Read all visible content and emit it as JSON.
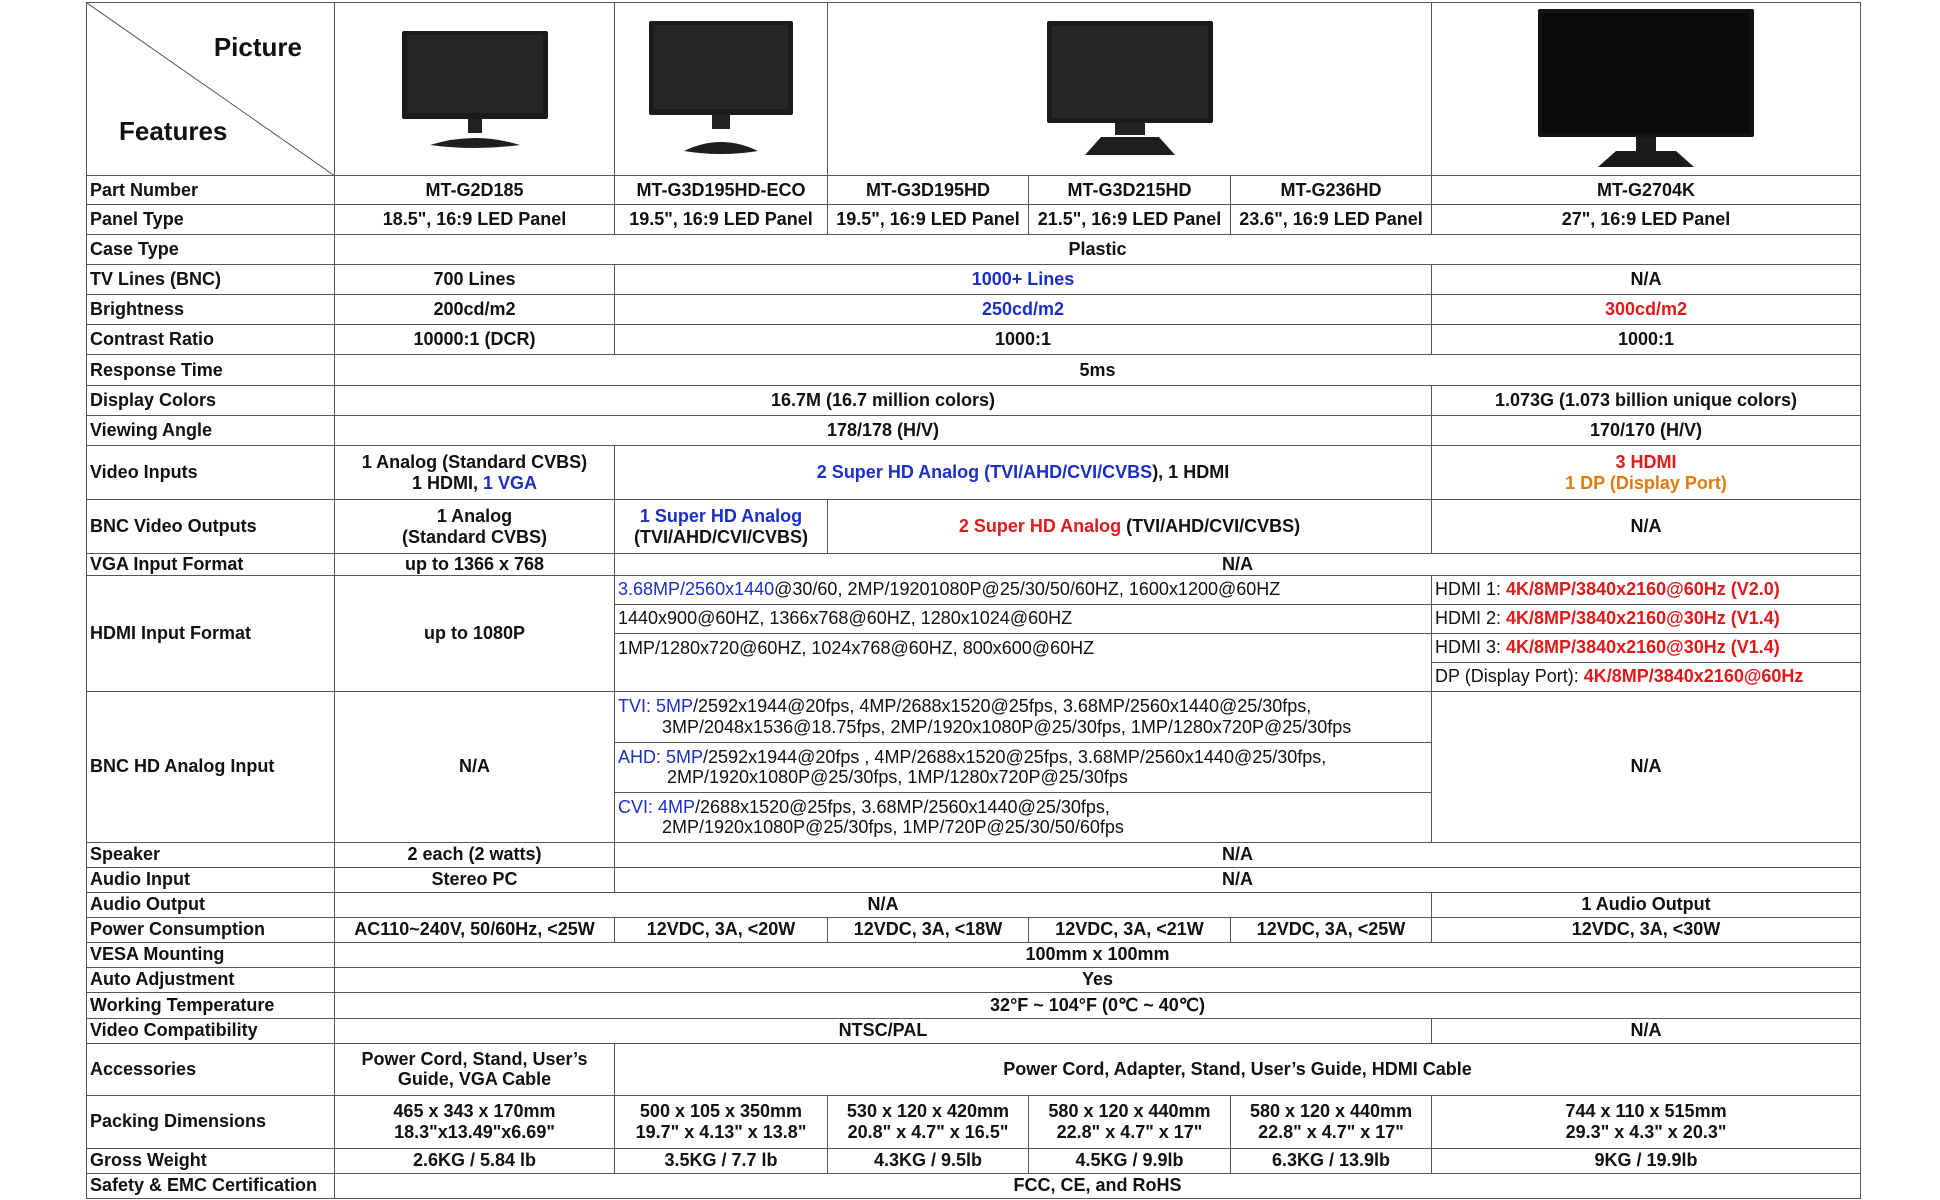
{
  "header": {
    "picture": "Picture",
    "features": "Features"
  },
  "rows": {
    "part_number": {
      "label": "Part Number",
      "v": [
        "MT-G2D185",
        "MT-G3D195HD-ECO",
        "MT-G3D195HD",
        "MT-G3D215HD",
        "MT-G236HD",
        "MT-G2704K"
      ]
    },
    "panel_type": {
      "label": "Panel Type",
      "v": [
        "18.5\", 16:9 LED Panel",
        "19.5\", 16:9 LED Panel",
        "19.5\", 16:9 LED Panel",
        "21.5\", 16:9 LED Panel",
        "23.6\", 16:9 LED Panel",
        "27\", 16:9 LED Panel"
      ]
    },
    "case_type": {
      "label": "Case Type",
      "v": "Plastic"
    },
    "tv_lines": {
      "label": "TV Lines (BNC)",
      "v": [
        "700 Lines",
        "1000+ Lines",
        "N/A"
      ]
    },
    "brightness": {
      "label": "Brightness",
      "v": [
        "200cd/m2",
        "250cd/m2",
        "300cd/m2"
      ]
    },
    "contrast": {
      "label": "Contrast Ratio",
      "v": [
        "10000:1 (DCR)",
        "1000:1",
        "1000:1"
      ]
    },
    "response": {
      "label": "Response Time",
      "v": "5ms"
    },
    "colors": {
      "label": "Display Colors",
      "v": [
        "16.7M (16.7 million colors)",
        "1.073G (1.073 billion unique colors)"
      ]
    },
    "viewing": {
      "label": "Viewing Angle",
      "v": [
        "178/178 (H/V)",
        "170/170 (H/V)"
      ]
    },
    "video_inputs": {
      "label": "Video Inputs",
      "c1a": "1 Analog (Standard CVBS)",
      "c1b": "1 HDMI, ",
      "c1c": "1 VGA",
      "c2a": "2 Super HD Analog (",
      "c2b": "TVI/AHD/CVI/CVBS",
      "c2c": "), 1 HDMI",
      "c3a": "3 HDMI",
      "c3b": "1 DP (Display Port)"
    },
    "bnc_out": {
      "label": "BNC Video Outputs",
      "c1a": "1 Analog",
      "c1b": "(Standard CVBS)",
      "c2a": "1 Super HD Analog",
      "c2b": "(TVI/AHD/CVI/CVBS)",
      "c3a": "2 Super HD Analog",
      "c3b": " (TVI/AHD/CVI/CVBS)",
      "c4": "N/A"
    },
    "vga": {
      "label": "VGA Input Format",
      "v": [
        "up to 1366 x 768",
        "N/A"
      ]
    },
    "hdmi_in": {
      "label": "HDMI Input Format",
      "c1": "up to 1080P",
      "mid1a": "3.68MP/2560x1440",
      "mid1b": "@30/60, 2MP/19201080P@25/30/50/60HZ, 1600x1200@60HZ",
      "mid2": "1440x900@60HZ, 1366x768@60HZ, 1280x1024@60HZ",
      "mid3": "1MP/1280x720@60HZ, 1024x768@60HZ, 800x600@60HZ",
      "r1a": "HDMI 1: ",
      "r1b": "4K/8MP/3840x2160@60Hz (V2.0)",
      "r2a": "HDMI 2: ",
      "r2b": "4K/8MP/3840x2160@30Hz (V1.4)",
      "r3a": "HDMI 3: ",
      "r3b": "4K/8MP/3840x2160@30Hz (V1.4)",
      "r4a": "DP (Display Port): ",
      "r4b": "4K/8MP/3840x2160@60Hz"
    },
    "bnc_hd": {
      "label": "BNC HD Analog Input",
      "c1": "N/A",
      "c3": "N/A",
      "tvi_a": "TVI: ",
      "tvi_b": "5MP",
      "tvi_c": "/2592x1944@20fps, 4MP/2688x1520@25fps, 3.68MP/2560x1440@25/30fps,",
      "tvi_d": "3MP/2048x1536@18.75fps, 2MP/1920x1080P@25/30fps, 1MP/1280x720P@25/30fps",
      "ahd_a": "AHD: ",
      "ahd_b": "5MP",
      "ahd_c": "/2592x1944@20fps , 4MP/2688x1520@25fps, 3.68MP/2560x1440@25/30fps,",
      "ahd_d": "2MP/1920x1080P@25/30fps, 1MP/1280x720P@25/30fps",
      "cvi_a": "CVI: ",
      "cvi_b": "4MP",
      "cvi_c": "/2688x1520@25fps, 3.68MP/2560x1440@25/30fps,",
      "cvi_d": "2MP/1920x1080P@25/30fps, 1MP/720P@25/30/50/60fps"
    },
    "speaker": {
      "label": "Speaker",
      "v": [
        "2 each (2 watts)",
        "N/A"
      ]
    },
    "audio_in": {
      "label": "Audio Input",
      "v": [
        "Stereo PC",
        "N/A"
      ]
    },
    "audio_out": {
      "label": "Audio Output",
      "v": [
        "N/A",
        "1 Audio Output"
      ]
    },
    "power": {
      "label": "Power Consumption",
      "v": [
        "AC110~240V, 50/60Hz, <25W",
        "12VDC, 3A, <20W",
        "12VDC, 3A, <18W",
        "12VDC, 3A, <21W",
        "12VDC, 3A, <25W",
        "12VDC, 3A, <30W"
      ]
    },
    "vesa": {
      "label": "VESA Mounting",
      "v": "100mm x 100mm"
    },
    "auto_adj": {
      "label": "Auto Adjustment",
      "v": "Yes"
    },
    "temp": {
      "label": "Working Temperature",
      "v": "32°F ~ 104°F (0℃ ~ 40℃)"
    },
    "compat": {
      "label": "Video Compatibility",
      "v": [
        "NTSC/PAL",
        "N/A"
      ]
    },
    "accessories": {
      "label": "Accessories",
      "c1a": "Power Cord, Stand, User’s",
      "c1b": "Guide, VGA Cable",
      "c2": "Power Cord, Adapter, Stand, User’s Guide, HDMI Cable"
    },
    "packing": {
      "label": "Packing Dimensions",
      "a": [
        "465 x 343 x 170mm",
        "500 x 105 x 350mm",
        "530 x 120 x 420mm",
        "580 x 120 x 440mm",
        "580 x 120 x 440mm",
        "744 x 110 x 515mm"
      ],
      "b": [
        "18.3\"x13.49\"x6.69\"",
        "19.7\" x 4.13\" x 13.8\"",
        "20.8\" x 4.7\" x 16.5\"",
        "22.8\" x 4.7\" x 17\"",
        "22.8\" x 4.7\" x 17\"",
        "29.3\" x 4.3\" x 20.3\""
      ]
    },
    "weight": {
      "label": "Gross Weight",
      "v": [
        "2.6KG / 5.84 lb",
        "3.5KG / 7.7 lb",
        "4.3KG / 9.5lb",
        "4.5KG / 9.9lb",
        "6.3KG / 13.9lb",
        "9KG / 19.9lb"
      ]
    },
    "cert": {
      "label": "Safety & EMC Certification",
      "v": "FCC, CE, and RoHS"
    }
  },
  "colors": {
    "blue": "#1a2fc8",
    "red": "#e01919",
    "orange": "#e07a10"
  }
}
